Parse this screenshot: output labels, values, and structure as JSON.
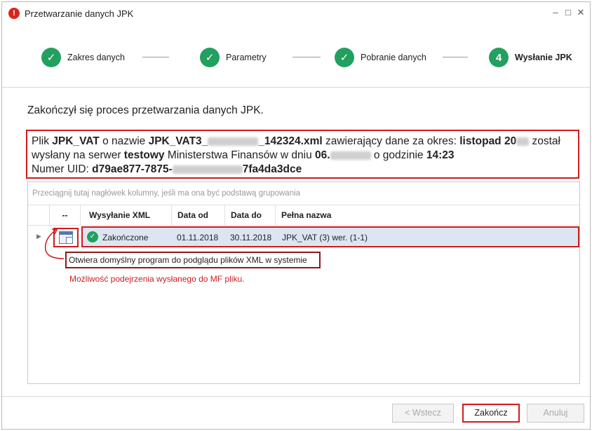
{
  "window": {
    "title": "Przetwarzanie danych JPK",
    "minimize": "–",
    "maximize": "□",
    "close": "✕"
  },
  "steps": [
    {
      "label": "Zakres danych",
      "state": "done",
      "icon": "check-icon"
    },
    {
      "label": "Parametry",
      "state": "done",
      "icon": "check-icon"
    },
    {
      "label": "Pobranie danych",
      "state": "done",
      "icon": "check-icon"
    },
    {
      "label": "Wysłanie JPK",
      "state": "current",
      "number": "4"
    }
  ],
  "message": "Zakończył się proces przetwarzania danych JPK.",
  "info": {
    "t1": "Plik ",
    "file_kind": "JPK_VAT",
    "t2": " o nazwie ",
    "file_name_start": "JPK_VAT3_",
    "file_name_end": "_142324.xml",
    "t3": " zawierający dane za okres: ",
    "period": "listopad 20",
    "t4": " został",
    "t5": "wysłany na serwer ",
    "server": "testowy",
    "t6": " Ministerstwa Finansów w dniu ",
    "date_start": "06.",
    "t7": " o godzinie ",
    "time": "14:23",
    "uid_label": "Numer UID: ",
    "uid_start": "d79ae877-7875-",
    "uid_end": "7fa4da3dce"
  },
  "grid": {
    "group_hint": "Przeciągnij tutaj nagłówek kolumny, jeśli ma ona być podstawą grupowania",
    "columns": [
      "--",
      "Wysyłanie XML",
      "Data od",
      "Data do",
      "Pełna nazwa"
    ],
    "rows": [
      {
        "status": "Zakończone",
        "date_from": "01.11.2018",
        "date_to": "30.11.2018",
        "full_name": "JPK_VAT (3) wer. (1-1)"
      }
    ]
  },
  "tooltip": "Otwiera domyślny program do podglądu plików XML w systemie",
  "annotation": "Możliwość podejrzenia wysłanego do MF pliku.",
  "buttons": {
    "back": "< Wstecz",
    "finish": "Zakończ",
    "cancel": "Anuluj"
  },
  "colors": {
    "step_green": "#22a05f",
    "highlight_red": "#d01c1c",
    "row_selected": "#dce6f2"
  }
}
